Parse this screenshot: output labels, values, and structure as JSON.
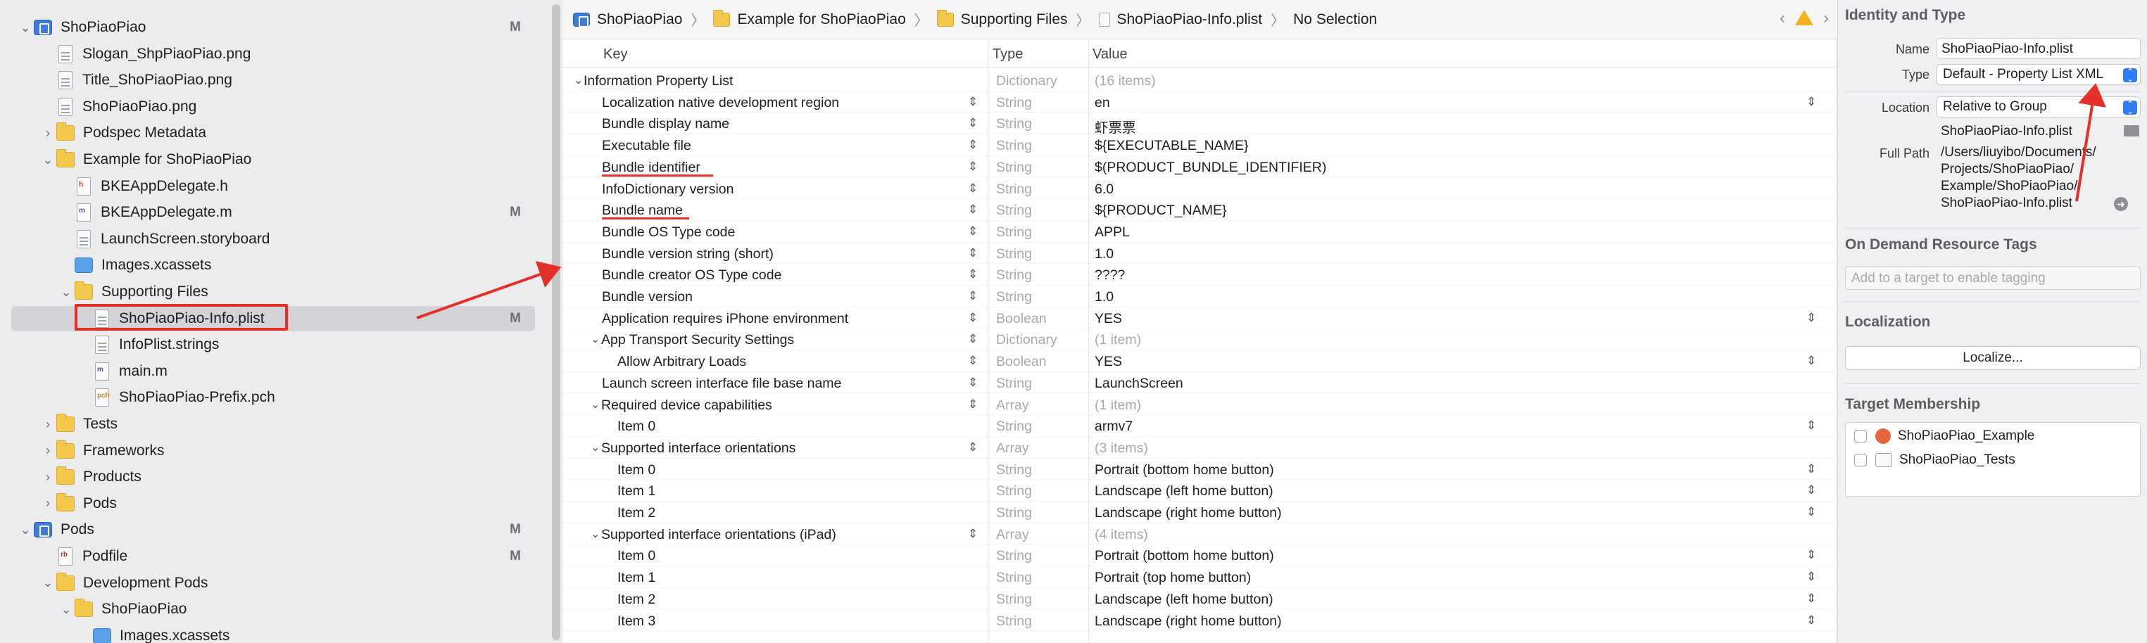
{
  "navigator": {
    "items": [
      {
        "label": "ShoPiaoPiao",
        "badge": "M",
        "indent": 0,
        "disclosure": "open",
        "icon": "project"
      },
      {
        "label": "Slogan_ShpPiaoPiao.png",
        "badge": "",
        "indent": 1,
        "disclosure": "none",
        "icon": "image"
      },
      {
        "label": "Title_ShoPiaoPiao.png",
        "badge": "",
        "indent": 1,
        "disclosure": "none",
        "icon": "image"
      },
      {
        "label": "ShoPiaoPiao.png",
        "badge": "",
        "indent": 1,
        "disclosure": "none",
        "icon": "image"
      },
      {
        "label": "Podspec Metadata",
        "badge": "",
        "indent": 1,
        "disclosure": "closed",
        "icon": "folder"
      },
      {
        "label": "Example for ShoPiaoPiao",
        "badge": "",
        "indent": 1,
        "disclosure": "open",
        "icon": "folder"
      },
      {
        "label": "BKEAppDelegate.h",
        "badge": "",
        "indent": 2,
        "disclosure": "none",
        "icon": "h"
      },
      {
        "label": "BKEAppDelegate.m",
        "badge": "M",
        "indent": 2,
        "disclosure": "none",
        "icon": "m"
      },
      {
        "label": "LaunchScreen.storyboard",
        "badge": "",
        "indent": 2,
        "disclosure": "none",
        "icon": "storyboard"
      },
      {
        "label": "Images.xcassets",
        "badge": "",
        "indent": 2,
        "disclosure": "none",
        "icon": "xcassets"
      },
      {
        "label": "Supporting Files",
        "badge": "",
        "indent": 2,
        "disclosure": "open",
        "icon": "folder"
      },
      {
        "label": "ShoPiaoPiao-Info.plist",
        "badge": "M",
        "indent": 3,
        "disclosure": "none",
        "icon": "plist",
        "selected": true
      },
      {
        "label": "InfoPlist.strings",
        "badge": "",
        "indent": 3,
        "disclosure": "none",
        "icon": "strings"
      },
      {
        "label": "main.m",
        "badge": "",
        "indent": 3,
        "disclosure": "none",
        "icon": "m"
      },
      {
        "label": "ShoPiaoPiao-Prefix.pch",
        "badge": "",
        "indent": 3,
        "disclosure": "none",
        "icon": "pch"
      },
      {
        "label": "Tests",
        "badge": "",
        "indent": 1,
        "disclosure": "closed",
        "icon": "folder"
      },
      {
        "label": "Frameworks",
        "badge": "",
        "indent": 1,
        "disclosure": "closed",
        "icon": "folder"
      },
      {
        "label": "Products",
        "badge": "",
        "indent": 1,
        "disclosure": "closed",
        "icon": "folder"
      },
      {
        "label": "Pods",
        "badge": "",
        "indent": 1,
        "disclosure": "closed",
        "icon": "folder"
      },
      {
        "label": "Pods",
        "badge": "M",
        "indent": 0,
        "disclosure": "open",
        "icon": "project"
      },
      {
        "label": "Podfile",
        "badge": "M",
        "indent": 1,
        "disclosure": "none",
        "icon": "rb"
      },
      {
        "label": "Development Pods",
        "badge": "",
        "indent": 1,
        "disclosure": "open",
        "icon": "folder"
      },
      {
        "label": "ShoPiaoPiao",
        "badge": "",
        "indent": 2,
        "disclosure": "open",
        "icon": "folder"
      },
      {
        "label": "Images.xcassets",
        "badge": "",
        "indent": 3,
        "disclosure": "none",
        "icon": "xcassets"
      }
    ]
  },
  "jumpbar": {
    "crumbs": [
      "ShoPiaoPiao",
      "Example for ShoPiaoPiao",
      "Supporting Files",
      "ShoPiaoPiao-Info.plist",
      "No Selection"
    ]
  },
  "plist": {
    "headers": {
      "key": "Key",
      "type": "Type",
      "value": "Value"
    },
    "rows": [
      {
        "key": "Information Property List",
        "type": "Dictionary",
        "value": "(16 items)",
        "level": 0,
        "disclosure": "open",
        "valueDim": true,
        "stepper": false,
        "popup": false
      },
      {
        "key": "Localization native development region",
        "type": "String",
        "value": "en",
        "level": 1,
        "stepper": true,
        "popup": true
      },
      {
        "key": "Bundle display name",
        "type": "String",
        "value": "虾票票",
        "level": 1,
        "stepper": true,
        "popup": false
      },
      {
        "key": "Executable file",
        "type": "String",
        "value": "${EXECUTABLE_NAME}",
        "level": 1,
        "stepper": true,
        "popup": false
      },
      {
        "key": "Bundle identifier",
        "type": "String",
        "value": "$(PRODUCT_BUNDLE_IDENTIFIER)",
        "level": 1,
        "stepper": true,
        "popup": false,
        "underline": true
      },
      {
        "key": "InfoDictionary version",
        "type": "String",
        "value": "6.0",
        "level": 1,
        "stepper": true,
        "popup": false
      },
      {
        "key": "Bundle name",
        "type": "String",
        "value": "${PRODUCT_NAME}",
        "level": 1,
        "stepper": true,
        "popup": false,
        "underline": true
      },
      {
        "key": "Bundle OS Type code",
        "type": "String",
        "value": "APPL",
        "level": 1,
        "stepper": true,
        "popup": false
      },
      {
        "key": "Bundle version string (short)",
        "type": "String",
        "value": "1.0",
        "level": 1,
        "stepper": true,
        "popup": false
      },
      {
        "key": "Bundle creator OS Type code",
        "type": "String",
        "value": "????",
        "level": 1,
        "stepper": true,
        "popup": false
      },
      {
        "key": "Bundle version",
        "type": "String",
        "value": "1.0",
        "level": 1,
        "stepper": true,
        "popup": false
      },
      {
        "key": "Application requires iPhone environment",
        "type": "Boolean",
        "value": "YES",
        "level": 1,
        "stepper": true,
        "popup": true
      },
      {
        "key": "App Transport Security Settings",
        "type": "Dictionary",
        "value": "(1 item)",
        "level": 1,
        "disclosure": "open",
        "valueDim": true,
        "stepper": true,
        "popup": false
      },
      {
        "key": "Allow Arbitrary Loads",
        "type": "Boolean",
        "value": "YES",
        "level": 2,
        "stepper": true,
        "popup": true
      },
      {
        "key": "Launch screen interface file base name",
        "type": "String",
        "value": "LaunchScreen",
        "level": 1,
        "stepper": true,
        "popup": false
      },
      {
        "key": "Required device capabilities",
        "type": "Array",
        "value": "(1 item)",
        "level": 1,
        "disclosure": "open",
        "valueDim": true,
        "stepper": true,
        "popup": false
      },
      {
        "key": "Item 0",
        "type": "String",
        "value": "armv7",
        "level": 2,
        "stepper": false,
        "popup": true
      },
      {
        "key": "Supported interface orientations",
        "type": "Array",
        "value": "(3 items)",
        "level": 1,
        "disclosure": "open",
        "valueDim": true,
        "stepper": true,
        "popup": false
      },
      {
        "key": "Item 0",
        "type": "String",
        "value": "Portrait (bottom home button)",
        "level": 2,
        "stepper": false,
        "popup": true
      },
      {
        "key": "Item 1",
        "type": "String",
        "value": "Landscape (left home button)",
        "level": 2,
        "stepper": false,
        "popup": true
      },
      {
        "key": "Item 2",
        "type": "String",
        "value": "Landscape (right home button)",
        "level": 2,
        "stepper": false,
        "popup": true
      },
      {
        "key": "Supported interface orientations (iPad)",
        "type": "Array",
        "value": "(4 items)",
        "level": 1,
        "disclosure": "open",
        "valueDim": true,
        "stepper": true,
        "popup": false
      },
      {
        "key": "Item 0",
        "type": "String",
        "value": "Portrait (bottom home button)",
        "level": 2,
        "stepper": false,
        "popup": true
      },
      {
        "key": "Item 1",
        "type": "String",
        "value": "Portrait (top home button)",
        "level": 2,
        "stepper": false,
        "popup": true
      },
      {
        "key": "Item 2",
        "type": "String",
        "value": "Landscape (left home button)",
        "level": 2,
        "stepper": false,
        "popup": true
      },
      {
        "key": "Item 3",
        "type": "String",
        "value": "Landscape (right home button)",
        "level": 2,
        "stepper": false,
        "popup": true
      }
    ]
  },
  "inspector": {
    "identity_title": "Identity and Type",
    "name_label": "Name",
    "name_value": "ShoPiaoPiao-Info.plist",
    "type_label": "Type",
    "type_value": "Default - Property List XML",
    "location_label": "Location",
    "location_value": "Relative to Group",
    "location_file": "ShoPiaoPiao-Info.plist",
    "fullpath_label": "Full Path",
    "fullpath_lines": [
      "/Users/liuyibo/Documents/",
      "Projects/ShoPiaoPiao/",
      "Example/ShoPiaoPiao/",
      "ShoPiaoPiao-Info.plist"
    ],
    "odr_title": "On Demand Resource Tags",
    "odr_placeholder": "Add to a target to enable tagging",
    "localization_title": "Localization",
    "localize_button": "Localize...",
    "target_title": "Target Membership",
    "targets": [
      "ShoPiaoPiao_Example",
      "ShoPiaoPiao_Tests"
    ]
  },
  "colors": {
    "annotation": "#e5302a",
    "selection": "#d3d3d8",
    "accent": "#2f7cf6"
  }
}
